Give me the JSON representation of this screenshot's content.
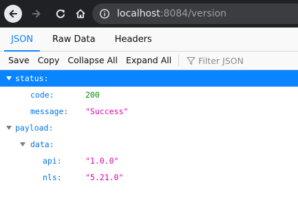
{
  "browser": {
    "url_host": "localhost",
    "url_rest": ":8084/version"
  },
  "viewer": {
    "tabs": [
      {
        "label": "JSON",
        "selected": true
      },
      {
        "label": "Raw Data",
        "selected": false
      },
      {
        "label": "Headers",
        "selected": false
      }
    ],
    "toolbar": {
      "save": "Save",
      "copy": "Copy",
      "collapse_all": "Collapse All",
      "expand_all": "Expand All",
      "filter_placeholder": "Filter JSON"
    }
  },
  "tree": {
    "status_key": "status:",
    "code_key": "code:",
    "code_val": "200",
    "message_key": "message:",
    "message_val": "\"Success\"",
    "payload_key": "payload:",
    "data_key": "data:",
    "api_key": "api:",
    "api_val": "\"1.0.0\"",
    "nls_key": "nls:",
    "nls_val": "\"5.21.0\""
  },
  "colors": {
    "accent": "#0a84ff",
    "key": "#0074e8",
    "number": "#058b00",
    "string": "#dd00a9",
    "chrome_bg": "#202124"
  }
}
